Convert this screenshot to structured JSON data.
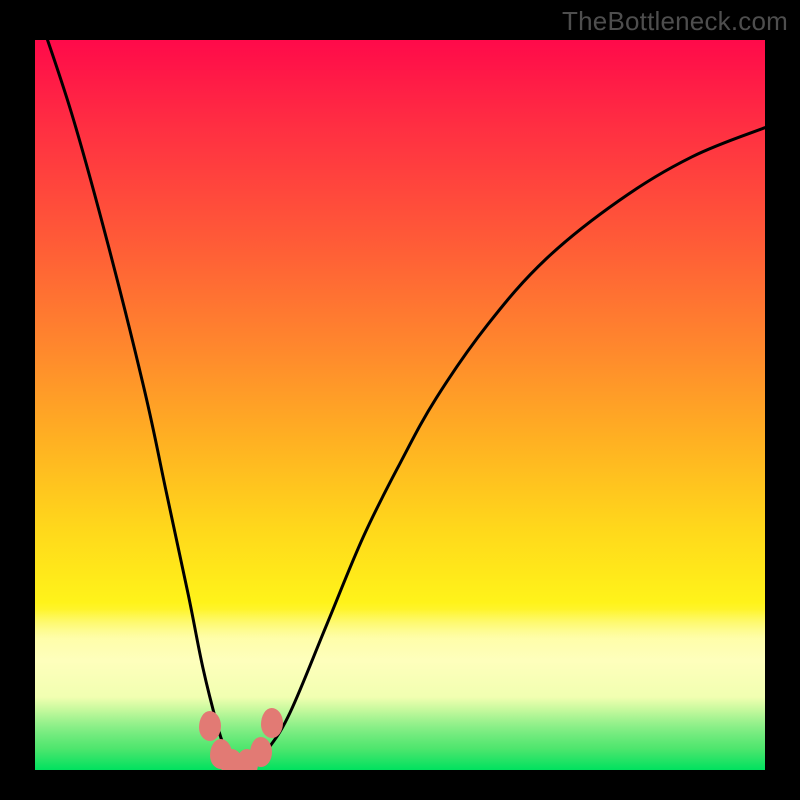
{
  "watermark": "TheBottleneck.com",
  "chart_data": {
    "type": "line",
    "title": "",
    "xlabel": "",
    "ylabel": "",
    "xlim": [
      0,
      100
    ],
    "ylim": [
      0,
      100
    ],
    "grid": false,
    "legend": false,
    "background": {
      "gradient_top_color": "#ff0a4a",
      "gradient_mid_color": "#ffe819",
      "gradient_bottom_color": "#00e05f"
    },
    "series": [
      {
        "name": "bottleneck-curve",
        "x": [
          0,
          5,
          10,
          15,
          18,
          21,
          23,
          25,
          26,
          27,
          28,
          29,
          30,
          32,
          35,
          40,
          45,
          50,
          55,
          62,
          70,
          80,
          90,
          100
        ],
        "y": [
          105,
          90,
          72,
          52,
          38,
          24,
          14,
          6,
          3,
          1,
          0,
          0,
          1,
          3,
          8,
          20,
          32,
          42,
          51,
          61,
          70,
          78,
          84,
          88
        ]
      }
    ],
    "markers": [
      {
        "name": "blob-left-upper",
        "x": 24.0,
        "y": 6.0
      },
      {
        "name": "blob-left-lower",
        "x": 25.5,
        "y": 2.2
      },
      {
        "name": "blob-bottom-1",
        "x": 27.0,
        "y": 0.8
      },
      {
        "name": "blob-bottom-2",
        "x": 29.0,
        "y": 0.8
      },
      {
        "name": "blob-right-lower",
        "x": 31.0,
        "y": 2.5
      },
      {
        "name": "blob-right-upper",
        "x": 32.5,
        "y": 6.5
      }
    ],
    "marker_color": "#e27a74",
    "curve_color": "#000000"
  }
}
